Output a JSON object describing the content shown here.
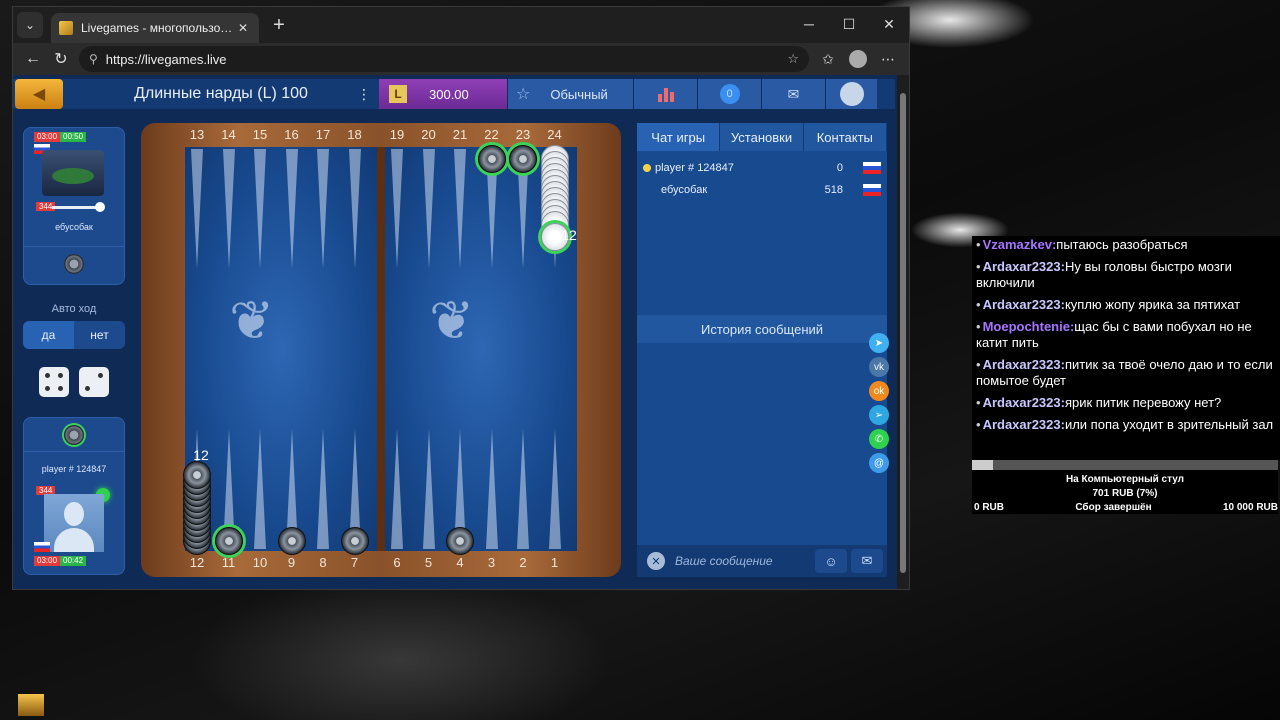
{
  "browser": {
    "tab_title": "Livegames - многопользовательские",
    "url": "https://livegames.live"
  },
  "game": {
    "title": "Длинные нарды (L) 100",
    "balance": "300.00",
    "mode": "Обычный",
    "msg_count": "0"
  },
  "players": {
    "top": {
      "time_total": "03:00",
      "time_turn": "00:50",
      "level": "344",
      "name": "ебусобак"
    },
    "bottom": {
      "time_total": "03:00",
      "time_turn": "00:42",
      "level": "344",
      "name": "player # 124847"
    }
  },
  "auto_move": {
    "label": "Авто ход",
    "yes": "да",
    "no": "нет"
  },
  "board": {
    "top_points": [
      "13",
      "14",
      "15",
      "16",
      "17",
      "18",
      "19",
      "20",
      "21",
      "22",
      "23",
      "24"
    ],
    "bottom_points": [
      "12",
      "11",
      "10",
      "9",
      "8",
      "7",
      "6",
      "5",
      "4",
      "3",
      "2",
      "1"
    ],
    "stack_top_right": "12",
    "stack_bottom_left": "12"
  },
  "right_panel": {
    "tabs": [
      "Чат игры",
      "Установки",
      "Контакты"
    ],
    "players": [
      {
        "name": "player # 124847",
        "score": "0"
      },
      {
        "name": "ебусобак",
        "score": "518"
      }
    ],
    "history_label": "История сообщений",
    "message_placeholder": "Ваше сообщение"
  },
  "chat": [
    {
      "user": "Vzamazkev:",
      "text": "пытаюсь разобраться"
    },
    {
      "user": "Ardaxar2323:",
      "text": "Ну вы головы быстро мозги включили"
    },
    {
      "user": "Ardaxar2323:",
      "text": "куплю жопу ярика за пятихат"
    },
    {
      "user": "Moepochtenie:",
      "text": "щас бы с вами побухал но не катит пить"
    },
    {
      "user": "Ardaxar2323:",
      "text": "питик за твоё очело даю и то если помытое будет"
    },
    {
      "user": "Ardaxar2323:",
      "text": "ярик питик перевожу нет?"
    },
    {
      "user": "Ardaxar2323:",
      "text": "или попа уходит в зрительный зал"
    }
  ],
  "donation": {
    "goal": "На Компьютерный стул",
    "amount": "701 RUB (7%)",
    "min": "0 RUB",
    "status": "Сбор завершён",
    "max": "10 000 RUB",
    "progress": 0.07
  }
}
